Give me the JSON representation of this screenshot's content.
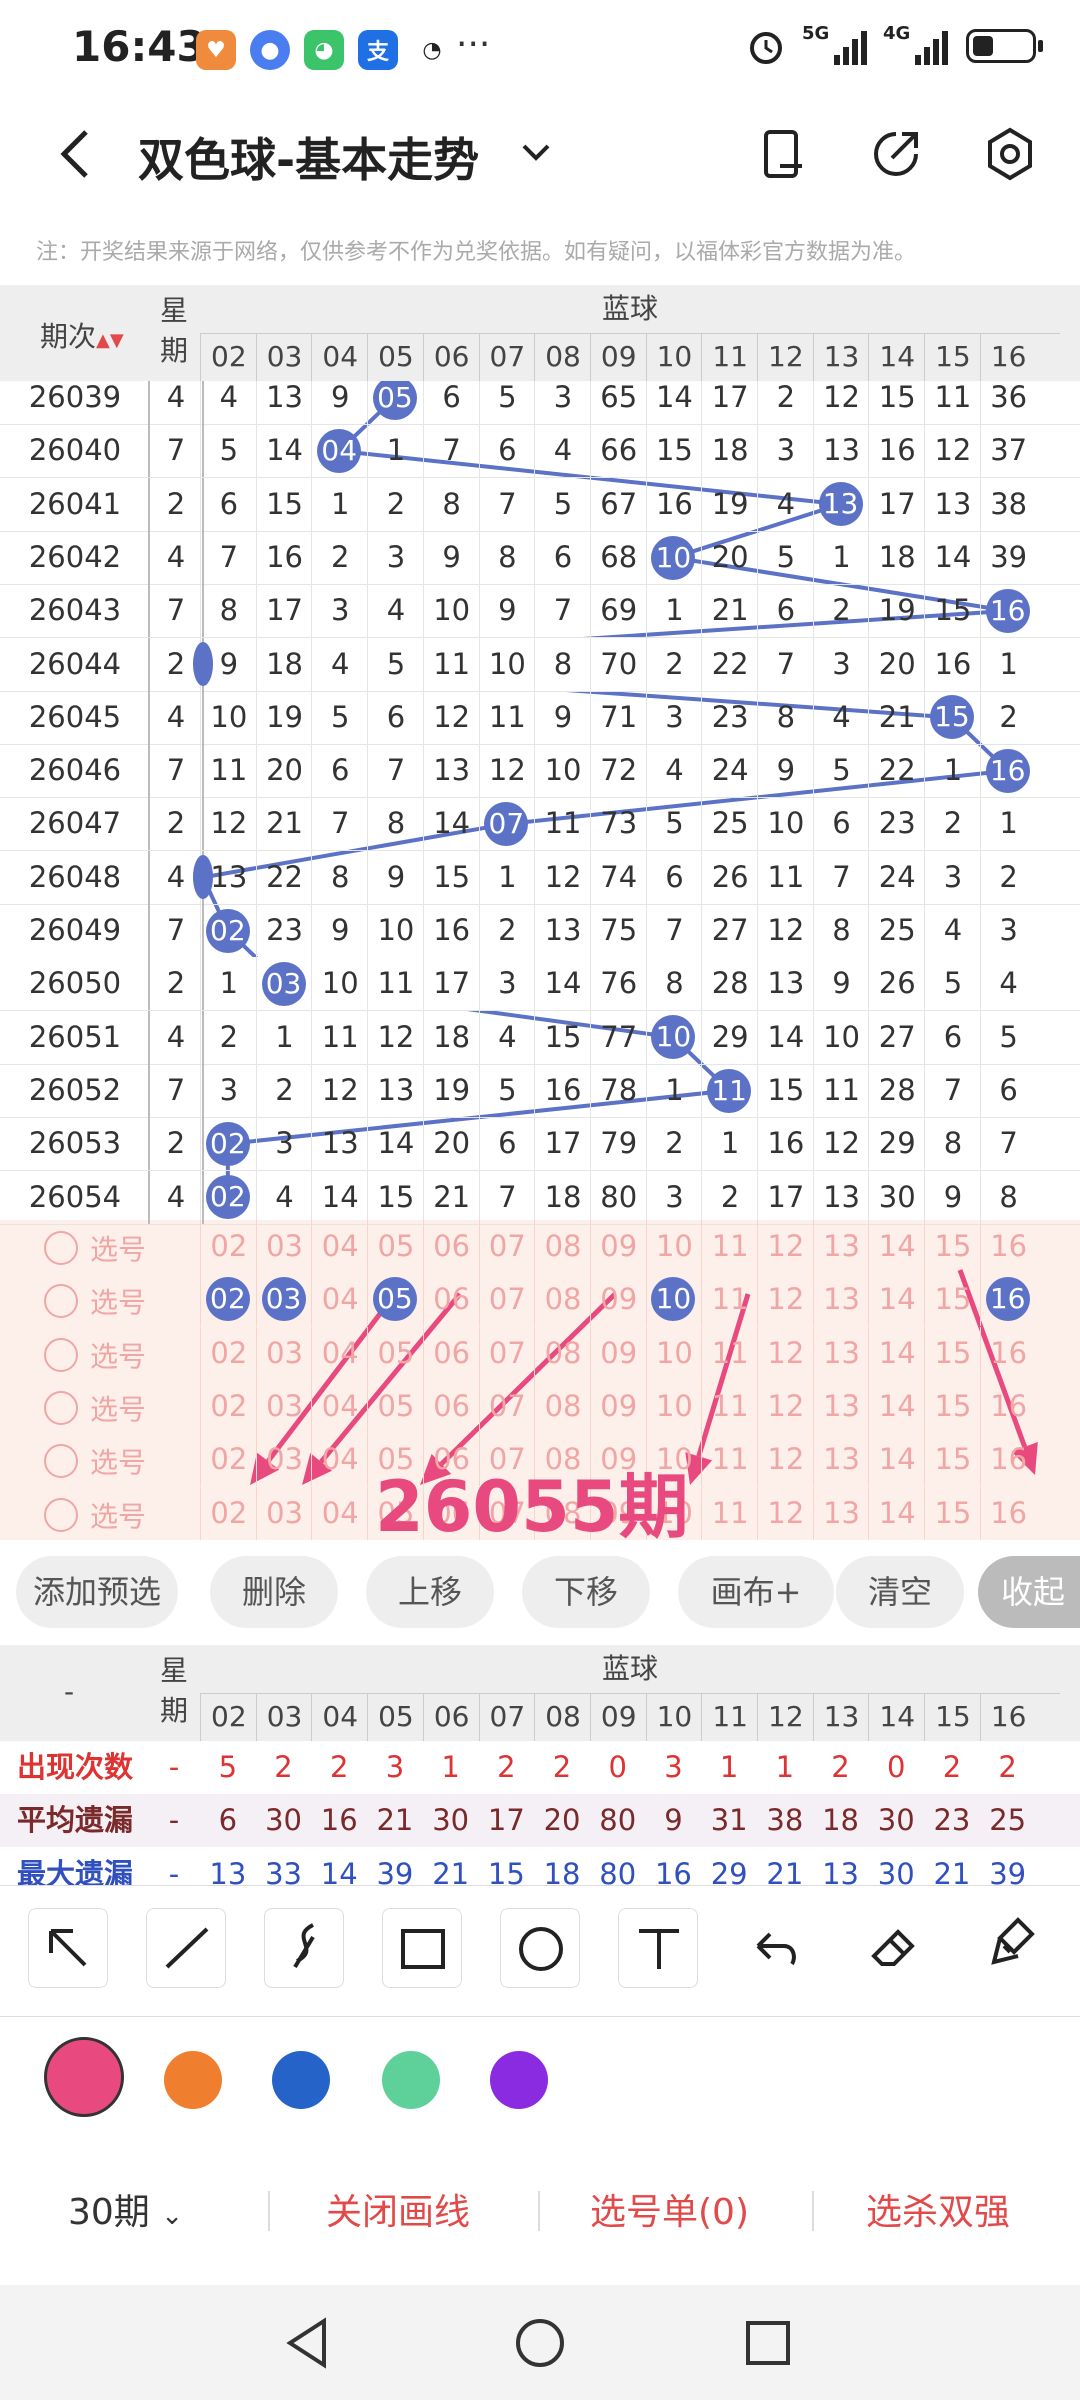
{
  "status": {
    "time": "16:43",
    "signal1": "5G",
    "signal2": "4G"
  },
  "header": {
    "title": "双色球-基本走势"
  },
  "notice": "注：开奖结果来源于网络，仅供参考不作为兑奖依据。如有疑问，以福体彩官方数据为准。",
  "table": {
    "col_period": "期次",
    "col_week": "星期",
    "col_week_top": "星",
    "col_week_bottom": "期",
    "group": "蓝球",
    "numbers": [
      "02",
      "03",
      "04",
      "05",
      "06",
      "07",
      "08",
      "09",
      "10",
      "11",
      "12",
      "13",
      "14",
      "15",
      "16"
    ],
    "rows": [
      {
        "period": "26039",
        "week": "4",
        "vals": [
          "4",
          "13",
          "9",
          "05",
          "6",
          "5",
          "3",
          "65",
          "14",
          "17",
          "2",
          "12",
          "15",
          "11",
          "36"
        ]
      },
      {
        "period": "26040",
        "week": "7",
        "vals": [
          "5",
          "14",
          "04",
          "1",
          "7",
          "6",
          "4",
          "66",
          "15",
          "18",
          "3",
          "13",
          "16",
          "12",
          "37"
        ]
      },
      {
        "period": "26041",
        "week": "2",
        "vals": [
          "6",
          "15",
          "1",
          "2",
          "8",
          "7",
          "5",
          "67",
          "16",
          "19",
          "4",
          "13",
          "17",
          "13",
          "38"
        ]
      },
      {
        "period": "26042",
        "week": "4",
        "vals": [
          "7",
          "16",
          "2",
          "3",
          "9",
          "8",
          "6",
          "68",
          "10",
          "20",
          "5",
          "1",
          "18",
          "14",
          "39"
        ]
      },
      {
        "period": "26043",
        "week": "7",
        "vals": [
          "8",
          "17",
          "3",
          "4",
          "10",
          "9",
          "7",
          "69",
          "1",
          "21",
          "6",
          "2",
          "19",
          "15",
          "16"
        ]
      },
      {
        "period": "26044",
        "week": "2",
        "vals": [
          "9",
          "18",
          "4",
          "5",
          "11",
          "10",
          "8",
          "70",
          "2",
          "22",
          "7",
          "3",
          "20",
          "16",
          "1"
        ]
      },
      {
        "period": "26045",
        "week": "4",
        "vals": [
          "10",
          "19",
          "5",
          "6",
          "12",
          "11",
          "9",
          "71",
          "3",
          "23",
          "8",
          "4",
          "21",
          "15",
          "2"
        ]
      },
      {
        "period": "26046",
        "week": "7",
        "vals": [
          "11",
          "20",
          "6",
          "7",
          "13",
          "12",
          "10",
          "72",
          "4",
          "24",
          "9",
          "5",
          "22",
          "1",
          "16"
        ]
      },
      {
        "period": "26047",
        "week": "2",
        "vals": [
          "12",
          "21",
          "7",
          "8",
          "14",
          "07",
          "11",
          "73",
          "5",
          "25",
          "10",
          "6",
          "23",
          "2",
          "1"
        ]
      },
      {
        "period": "26048",
        "week": "4",
        "vals": [
          "13",
          "22",
          "8",
          "9",
          "15",
          "1",
          "12",
          "74",
          "6",
          "26",
          "11",
          "7",
          "24",
          "3",
          "2"
        ]
      },
      {
        "period": "26049",
        "week": "7",
        "vals": [
          "02",
          "23",
          "9",
          "10",
          "16",
          "2",
          "13",
          "75",
          "7",
          "27",
          "12",
          "8",
          "25",
          "4",
          "3"
        ]
      },
      {
        "period": "26050",
        "week": "2",
        "vals": [
          "1",
          "03",
          "10",
          "11",
          "17",
          "3",
          "14",
          "76",
          "8",
          "28",
          "13",
          "9",
          "26",
          "5",
          "4"
        ]
      },
      {
        "period": "26051",
        "week": "4",
        "vals": [
          "2",
          "1",
          "11",
          "12",
          "18",
          "4",
          "15",
          "77",
          "10",
          "29",
          "14",
          "10",
          "27",
          "6",
          "5"
        ]
      },
      {
        "period": "26052",
        "week": "7",
        "vals": [
          "3",
          "2",
          "12",
          "13",
          "19",
          "5",
          "16",
          "78",
          "1",
          "11",
          "15",
          "11",
          "28",
          "7",
          "6"
        ]
      },
      {
        "period": "26053",
        "week": "2",
        "vals": [
          "02",
          "3",
          "13",
          "14",
          "20",
          "6",
          "17",
          "79",
          "2",
          "1",
          "16",
          "12",
          "29",
          "8",
          "7"
        ]
      },
      {
        "period": "26054",
        "week": "4",
        "vals": [
          "02",
          "4",
          "14",
          "15",
          "21",
          "7",
          "18",
          "80",
          "3",
          "2",
          "17",
          "13",
          "30",
          "9",
          "8"
        ]
      }
    ],
    "edge_vals": [
      "0",
      "",
      "2",
      "3",
      "4",
      "",
      "",
      "",
      "",
      "",
      "",
      "",
      "",
      "",
      ""
    ],
    "hit_balls": [
      {
        "row": 0,
        "col": 3
      },
      {
        "row": 1,
        "col": 2
      },
      {
        "row": 2,
        "col": 11
      },
      {
        "row": 3,
        "col": 8
      },
      {
        "row": 4,
        "col": 14
      },
      {
        "row": 5,
        "col": -1
      },
      {
        "row": 6,
        "col": 13
      },
      {
        "row": 7,
        "col": 14
      },
      {
        "row": 8,
        "col": 5
      },
      {
        "row": 9,
        "col": -1
      },
      {
        "row": 10,
        "col": 0
      },
      {
        "row": 11,
        "col": 1
      },
      {
        "row": 12,
        "col": 8
      },
      {
        "row": 13,
        "col": 9
      },
      {
        "row": 14,
        "col": 0
      },
      {
        "row": 15,
        "col": 0
      }
    ],
    "ball_labels": [
      "05",
      "04",
      "13",
      "10",
      "16",
      "",
      "15",
      "16",
      "07",
      "",
      "02",
      "03",
      "10",
      "11",
      "02",
      "02"
    ]
  },
  "picks": {
    "label": "选号",
    "rows": 6,
    "selected_row_balls": [
      {
        "col": 0,
        "label": "02"
      },
      {
        "col": 1,
        "label": "03"
      },
      {
        "col": 3,
        "label": "05"
      },
      {
        "col": 8,
        "label": "10"
      },
      {
        "col": 14,
        "label": "16"
      }
    ],
    "overlay_text": "26055期"
  },
  "buttons": [
    "添加预选",
    "删除",
    "上移",
    "下移",
    "画布+",
    "清空",
    "收起"
  ],
  "stats": {
    "week_top": "星",
    "week_bottom": "期",
    "group": "蓝球",
    "dash": "-",
    "rows": [
      {
        "label": "出现次数",
        "edge": "-",
        "vals": [
          "5",
          "2",
          "2",
          "3",
          "1",
          "2",
          "2",
          "0",
          "3",
          "1",
          "1",
          "2",
          "0",
          "2",
          "2"
        ]
      },
      {
        "label": "平均遗漏",
        "edge": "-",
        "vals": [
          "6",
          "30",
          "16",
          "21",
          "30",
          "17",
          "20",
          "80",
          "9",
          "31",
          "38",
          "18",
          "30",
          "23",
          "25"
        ]
      },
      {
        "label": "最大遗漏",
        "edge": "-",
        "vals": [
          "13",
          "33",
          "14",
          "39",
          "21",
          "15",
          "18",
          "80",
          "16",
          "29",
          "21",
          "13",
          "30",
          "21",
          "39"
        ]
      }
    ]
  },
  "tools": [
    "arrow-tool",
    "line-tool",
    "curve-tool",
    "rect-tool",
    "circle-tool",
    "text-tool",
    "undo-tool",
    "eraser-tool",
    "brush-tool"
  ],
  "colors": [
    "#e84a7f",
    "#ef7f2f",
    "#2563c9",
    "#5ed19a",
    "#8a2be2"
  ],
  "bottom": {
    "periods": "30期",
    "close_lines": "关闭画线",
    "pick_list": "选号单(0)",
    "kill": "选杀双强"
  }
}
